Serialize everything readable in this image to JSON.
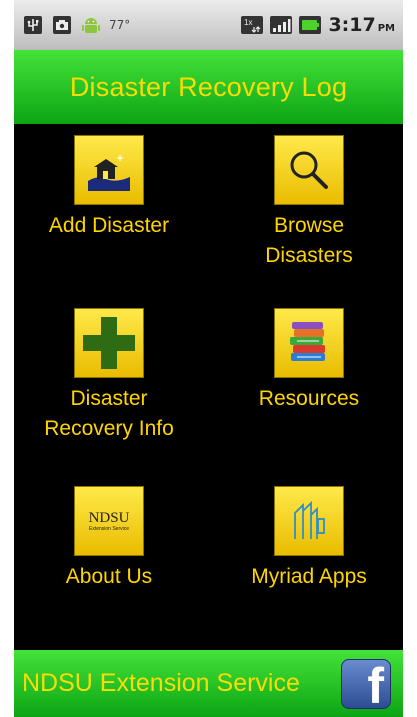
{
  "status_bar": {
    "temperature": "77°",
    "time": "3:17",
    "ampm": "PM",
    "icons": [
      "usb-icon",
      "camera-icon",
      "android-icon",
      "data-1x-icon",
      "signal-icon",
      "battery-icon"
    ]
  },
  "title": "Disaster Recovery Log",
  "menu": [
    {
      "label": "Add Disaster",
      "icon": "house-icon"
    },
    {
      "label": "Browse\nDisasters",
      "icon": "magnifier-icon"
    },
    {
      "label": "Disaster\nRecovery Info",
      "icon": "green-cross-icon"
    },
    {
      "label": "Resources",
      "icon": "books-icon"
    },
    {
      "label": "About Us",
      "icon": "ndsu-logo-icon"
    },
    {
      "label": "Myriad Apps",
      "icon": "myriad-logo-icon"
    }
  ],
  "ndsu_logo": {
    "line1": "NDSU",
    "line2": "Extension Service"
  },
  "footer": {
    "text": "NDSU Extension Service",
    "facebook_letter": "f"
  },
  "colors": {
    "bar_green": "#14b21b",
    "title_yellow": "#f7dc06",
    "label_yellow": "#ffd500",
    "background": "#000000"
  }
}
